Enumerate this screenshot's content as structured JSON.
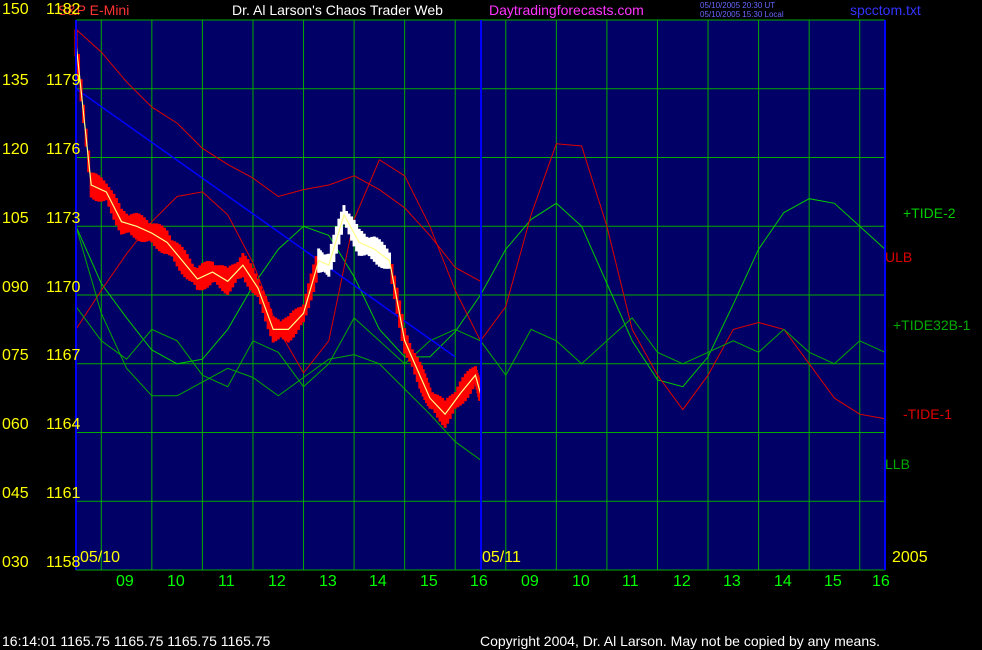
{
  "header": {
    "instrument": "S&P E-Mini",
    "title": "Dr. Al Larson's Chaos Trader Web",
    "website": "Daytradingforecasts.com",
    "utc_time": "05/10/2005 20:30 UT",
    "local_time": "05/10/2005 15:30 Local",
    "filename": "spcctom.txt"
  },
  "footer": {
    "quote": "16:14:01  1165.75 1165.75 1165.75 1165.75",
    "copyright": "Copyright 2004, Dr. Al Larson. May not be copied by any means."
  },
  "colors": {
    "background": "#000000",
    "plot_background": "#000066",
    "grid": "#00aa00",
    "price_bars": "#ff0000",
    "price_white": "#ffffff",
    "moving_average": "#ffff88",
    "trend_line": "#0000ff",
    "tide_2": "#00cc00",
    "tide32b": "#00aa00",
    "ulb": "#dd0000",
    "tide_1": "#dd0000",
    "llb": "#00aa00",
    "axis_text": "#ffff00",
    "time_text": "#00ff00"
  },
  "chart_data": {
    "type": "line",
    "title": "Dr. Al Larson's Chaos Trader Web",
    "y_left_ticks": [
      "150",
      "135",
      "120",
      "105",
      "090",
      "075",
      "060",
      "045",
      "030"
    ],
    "y_right_ticks": [
      "1182",
      "1179",
      "1176",
      "1173",
      "1170",
      "1167",
      "1164",
      "1161",
      "1158"
    ],
    "ylim": [
      1158,
      1182
    ],
    "x_time_ticks": [
      "09",
      "10",
      "11",
      "12",
      "13",
      "14",
      "15",
      "16",
      "09",
      "10",
      "11",
      "12",
      "13",
      "14",
      "15",
      "16"
    ],
    "date_labels": [
      "05/10",
      "05/11"
    ],
    "year": "2005",
    "legend": [
      {
        "name": "+TIDE-2",
        "color": "#00cc00"
      },
      {
        "name": "ULB",
        "color": "#dd0000"
      },
      {
        "name": "+TIDE32B-1",
        "color": "#00aa00"
      },
      {
        "name": "-TIDE-1",
        "color": "#dd0000"
      },
      {
        "name": "LLB",
        "color": "#00aa00"
      }
    ],
    "series": [
      {
        "name": "+TIDE-2",
        "x": [
          8.0,
          8.5,
          9.0,
          9.5,
          10.0,
          10.5,
          11.0,
          11.5,
          12.0,
          12.5,
          13.0,
          13.5,
          14.0,
          14.5,
          15.0,
          15.5,
          16.0,
          16.5,
          17.0,
          17.5,
          18.0,
          18.5,
          19.0,
          19.5,
          20.0,
          20.5,
          21.0,
          21.5,
          22.0,
          22.5,
          23.0,
          23.5,
          24.0
        ],
        "y": [
          1173.0,
          1170.5,
          1169.0,
          1167.6,
          1167.0,
          1167.2,
          1168.5,
          1170.4,
          1172.0,
          1173.0,
          1172.6,
          1170.8,
          1168.5,
          1167.3,
          1167.3,
          1168.4,
          1170.0,
          1172.0,
          1173.3,
          1174.0,
          1173.0,
          1170.5,
          1168.0,
          1166.3,
          1166.0,
          1167.3,
          1169.6,
          1172.0,
          1173.6,
          1174.2,
          1174.0,
          1173.0,
          1172.0
        ]
      },
      {
        "name": "ULB",
        "x": [
          8.0,
          8.5,
          9.0,
          9.5,
          10.0,
          10.5,
          11.0,
          11.5,
          12.0,
          12.5,
          13.0,
          13.5,
          14.0,
          14.5,
          15.0,
          15.5,
          16.0
        ],
        "y": [
          1181.6,
          1180.6,
          1179.3,
          1178.2,
          1177.5,
          1176.4,
          1175.7,
          1175.1,
          1174.3,
          1174.6,
          1174.8,
          1175.2,
          1174.6,
          1173.8,
          1172.6,
          1171.2,
          1170.6
        ]
      },
      {
        "name": "-TIDE-1",
        "x": [
          8.0,
          8.5,
          9.0,
          9.5,
          10.0,
          10.5,
          11.0,
          11.5,
          12.0,
          12.5,
          13.0,
          13.5,
          14.0,
          14.5,
          15.0,
          15.5,
          16.0,
          16.5,
          17.0,
          17.5,
          18.0,
          18.5,
          19.0,
          19.5,
          20.0,
          20.5,
          21.0,
          21.5,
          22.0,
          22.5,
          23.0,
          23.5,
          24.0
        ],
        "y": [
          1168.5,
          1170.2,
          1171.8,
          1173.2,
          1174.3,
          1174.5,
          1173.5,
          1171.4,
          1168.5,
          1166.6,
          1168.0,
          1173.3,
          1175.9,
          1175.2,
          1173.0,
          1170.2,
          1168.0,
          1169.5,
          1173.5,
          1176.6,
          1176.5,
          1173.0,
          1168.5,
          1166.5,
          1165.0,
          1166.5,
          1168.5,
          1168.8,
          1168.5,
          1167.0,
          1165.5,
          1164.8,
          1164.6
        ]
      },
      {
        "name": "LLB",
        "x": [
          8.0,
          8.5,
          9.0,
          9.5,
          10.0,
          10.5,
          11.0,
          11.5,
          12.0,
          12.5,
          13.0,
          13.5,
          14.0,
          14.5,
          15.0,
          15.5,
          16.0
        ],
        "y": [
          1173.0,
          1169.2,
          1166.8,
          1165.6,
          1165.6,
          1166.2,
          1166.8,
          1166.4,
          1165.6,
          1166.4,
          1167.2,
          1167.4,
          1167.0,
          1165.9,
          1164.8,
          1163.6,
          1162.8
        ]
      },
      {
        "name": "+TIDE32B-1",
        "x": [
          8.0,
          8.5,
          9.0,
          9.5,
          10.0,
          10.5,
          11.0,
          11.5,
          12.0,
          12.5,
          13.0,
          13.5,
          14.0,
          14.5,
          15.0,
          15.5,
          16.0,
          16.5,
          17.0,
          17.5,
          18.0,
          18.5,
          19.0,
          19.5,
          20.0,
          20.5,
          21.0,
          21.5,
          22.0,
          22.5,
          23.0,
          23.5,
          24.0
        ],
        "y": [
          1169.5,
          1168.0,
          1167.2,
          1168.5,
          1168.0,
          1166.5,
          1166.0,
          1168.0,
          1167.5,
          1166.0,
          1167.0,
          1169.0,
          1168.0,
          1167.0,
          1168.0,
          1168.5,
          1168.0,
          1166.5,
          1168.5,
          1168.0,
          1167.0,
          1168.0,
          1169.0,
          1167.5,
          1167.0,
          1167.5,
          1168.0,
          1167.5,
          1168.5,
          1167.5,
          1167.0,
          1168.0,
          1167.5
        ]
      },
      {
        "name": "price",
        "x": [
          8.0,
          8.3,
          8.6,
          8.9,
          9.2,
          9.5,
          9.8,
          10.1,
          10.4,
          10.7,
          11.0,
          11.3,
          11.6,
          11.9,
          12.2,
          12.5,
          12.8,
          13.0,
          13.3,
          13.6,
          13.9,
          14.2,
          14.5,
          14.8,
          15.0,
          15.3,
          15.6,
          15.9,
          16.0
        ],
        "y": [
          1181.0,
          1174.8,
          1174.5,
          1173.2,
          1173.0,
          1172.7,
          1172.3,
          1171.5,
          1170.7,
          1171.0,
          1170.6,
          1171.3,
          1170.3,
          1168.5,
          1168.5,
          1169.2,
          1171.5,
          1171.3,
          1173.5,
          1172.3,
          1172.0,
          1171.5,
          1168.0,
          1166.5,
          1165.5,
          1164.8,
          1165.7,
          1166.5,
          1165.7
        ]
      }
    ]
  }
}
